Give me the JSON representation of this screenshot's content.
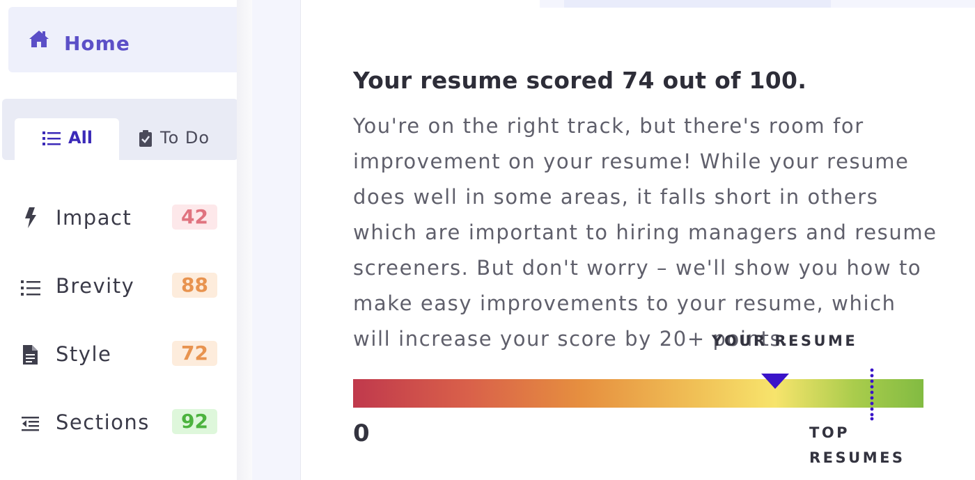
{
  "sidebar": {
    "home_label": "Home",
    "tabs": {
      "all_label": "All",
      "todo_label": "To Do"
    },
    "categories": [
      {
        "label": "Impact",
        "score": "42",
        "icon": "bolt-icon",
        "badge_bg": "#fde8ea",
        "badge_color": "#e0737f"
      },
      {
        "label": "Brevity",
        "score": "88",
        "icon": "list-icon",
        "badge_bg": "#fdecdc",
        "badge_color": "#e8934f"
      },
      {
        "label": "Style",
        "score": "72",
        "icon": "document-icon",
        "badge_bg": "#fdecdc",
        "badge_color": "#e8934f"
      },
      {
        "label": "Sections",
        "score": "92",
        "icon": "indent-icon",
        "badge_bg": "#def7db",
        "badge_color": "#4cb33e"
      }
    ]
  },
  "main": {
    "score_title": "Your resume scored 74 out of 100.",
    "score_description": "You're on the right track, but there's room for improvement on your resume! While your resume does well in some areas, it falls short in others which are important to hiring managers and resume screeners. But don't worry – we'll show you how to make easy improvements to your resume, which will increase your score by 20+ points.",
    "gauge": {
      "marker_label": "YOUR RESUME",
      "min_label": "0",
      "top_label": "TOP RESUMES",
      "score": 74
    }
  },
  "colors": {
    "accent": "#5b4fc7",
    "accent_dark": "#3b2ab8",
    "pointer": "#3a14c9"
  }
}
